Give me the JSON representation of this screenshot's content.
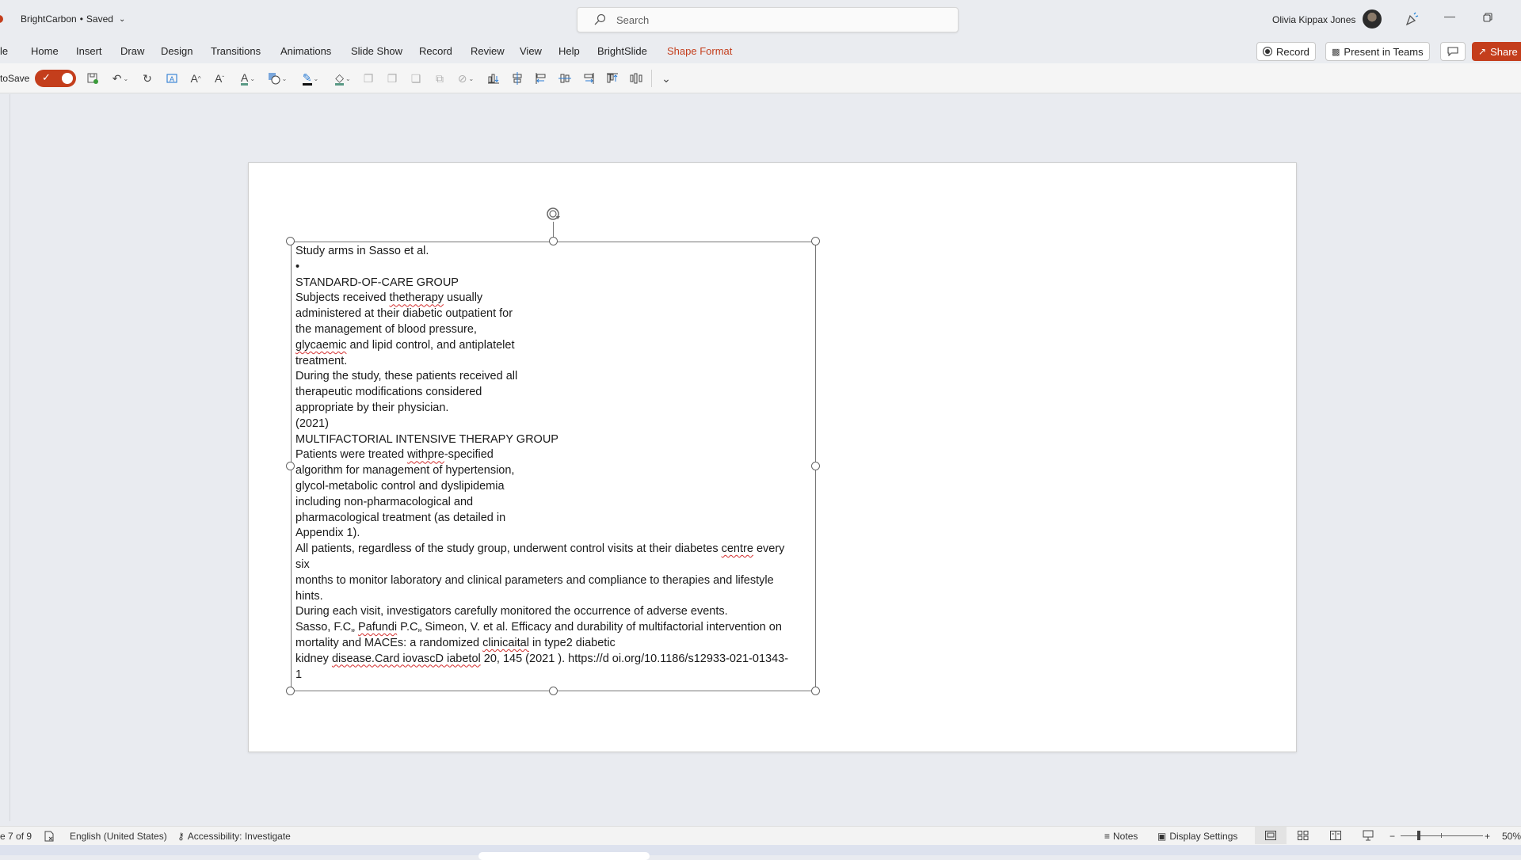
{
  "titlebar": {
    "doc_name": "BrightCarbon",
    "separator": "•",
    "save_status": "Saved",
    "search_placeholder": "Search",
    "user_name": "Olivia Kippax Jones"
  },
  "ribbon": {
    "tabs": [
      "File",
      "Home",
      "Insert",
      "Draw",
      "Design",
      "Transitions",
      "Animations",
      "Slide Show",
      "Record",
      "Review",
      "View",
      "Help",
      "BrightSlide",
      "Shape Format"
    ],
    "visible_first_tab": "le",
    "active_tab": "Shape Format",
    "buttons": {
      "record": "Record",
      "present_in_teams": "Present in Teams",
      "share": "Share"
    }
  },
  "toolbar": {
    "autosave_label": "toSave",
    "autosave_on": true,
    "tools": [
      {
        "name": "save-icon",
        "glyph": "🖫"
      },
      {
        "name": "undo-icon",
        "glyph": "↶"
      },
      {
        "name": "redo-icon",
        "glyph": "↻"
      },
      {
        "name": "fit-text-icon",
        "glyph": "A"
      },
      {
        "name": "increase-font-icon",
        "glyph": "A^"
      },
      {
        "name": "decrease-font-icon",
        "glyph": "Aˇ"
      },
      {
        "name": "font-color-icon",
        "glyph": "A"
      },
      {
        "name": "shapes-icon",
        "glyph": "◧"
      },
      {
        "name": "shape-outline-icon",
        "glyph": "✎"
      },
      {
        "name": "shape-fill-icon",
        "glyph": "◇"
      },
      {
        "name": "bring-forward-icon",
        "glyph": "❐"
      },
      {
        "name": "send-backward-icon",
        "glyph": "❐"
      },
      {
        "name": "bring-to-front-icon",
        "glyph": "❏"
      },
      {
        "name": "group-icon",
        "glyph": "⧉"
      },
      {
        "name": "merge-shapes-icon",
        "glyph": "⊘"
      },
      {
        "name": "align-bottom-icon",
        "glyph": "⫠"
      },
      {
        "name": "align-center-icon",
        "glyph": "⌶"
      },
      {
        "name": "align-left-icon",
        "glyph": "⊫"
      },
      {
        "name": "align-middle-icon",
        "glyph": "⊪"
      },
      {
        "name": "align-right-icon",
        "glyph": "⊨"
      },
      {
        "name": "align-top-icon",
        "glyph": "⊤"
      },
      {
        "name": "distribute-horizontal-icon",
        "glyph": "⫼"
      },
      {
        "name": "customize-toolbar-icon",
        "glyph": "⌄"
      }
    ]
  },
  "slide": {
    "textbox_lines": [
      {
        "text": "Study arms in Sasso et al."
      },
      {
        "text": "•"
      },
      {
        "text": "STANDARD-OF-CARE GROUP"
      },
      {
        "pre": "Subjects received ",
        "sq": "thetherapy",
        "post": " usually"
      },
      {
        "text": "administered at their diabetic outpatient for"
      },
      {
        "text": "the management of blood pressure,"
      },
      {
        "pre": "",
        "sq": "glycaemic",
        "post": " and lipid control, and antiplatelet"
      },
      {
        "text": "treatment."
      },
      {
        "text": "During the study, these patients received all"
      },
      {
        "text": "therapeutic modifications considered"
      },
      {
        "text": "appropriate by their physician."
      },
      {
        "text": "(2021)"
      },
      {
        "text": "MULTIFACTORIAL INTENSIVE THERAPY GROUP"
      },
      {
        "pre": "Patients were treated ",
        "sq": "withpre",
        "post": "-specified"
      },
      {
        "text": "algorithm for management of hypertension,"
      },
      {
        "text": "glycol-metabolic control and dyslipidemia"
      },
      {
        "text": "including non-pharmacological and"
      },
      {
        "text": "pharmacological treatment (as detailed in"
      },
      {
        "text": "Appendix 1)."
      },
      {
        "pre": "All patients, regardless of the study group, underwent control visits at their diabetes ",
        "sq": "centre",
        "post": " every"
      },
      {
        "text": "six"
      },
      {
        "text": "months to monitor laboratory and clinical parameters and compliance to therapies and lifestyle"
      },
      {
        "text": "hints."
      },
      {
        "text": "During each visit, investigators carefully monitored the occurrence of adverse events."
      },
      {
        "pre": "Sasso, F.C„ ",
        "sq": "Pafundi",
        "post": " P.C„ Simeon, V. et al. Efficacy and durability of multifactorial intervention on"
      },
      {
        "pre": "mortality and MACEs: a randomized ",
        "sq": "clinicaital",
        "post": " in type2 diabetic"
      },
      {
        "pre": "kidney ",
        "sq": "disease.Card iovascD iabetol",
        "post": " 20, 145 (2021 ). https://d oi.org/10.1186/s12933-021-01343-"
      },
      {
        "text": "1"
      }
    ]
  },
  "statusbar": {
    "slide_counter": "e 7 of 9",
    "language": "English (United States)",
    "accessibility": "Accessibility: Investigate",
    "notes": "Notes",
    "display_settings": "Display Settings",
    "zoom_minus": "−",
    "zoom_plus": "+",
    "zoom_level": "50%",
    "zoom_fraction": 0.5
  },
  "colors": {
    "accent": "#c43e1c",
    "chrome": "#eaecf0",
    "spelling_error": "#d32f2f"
  }
}
